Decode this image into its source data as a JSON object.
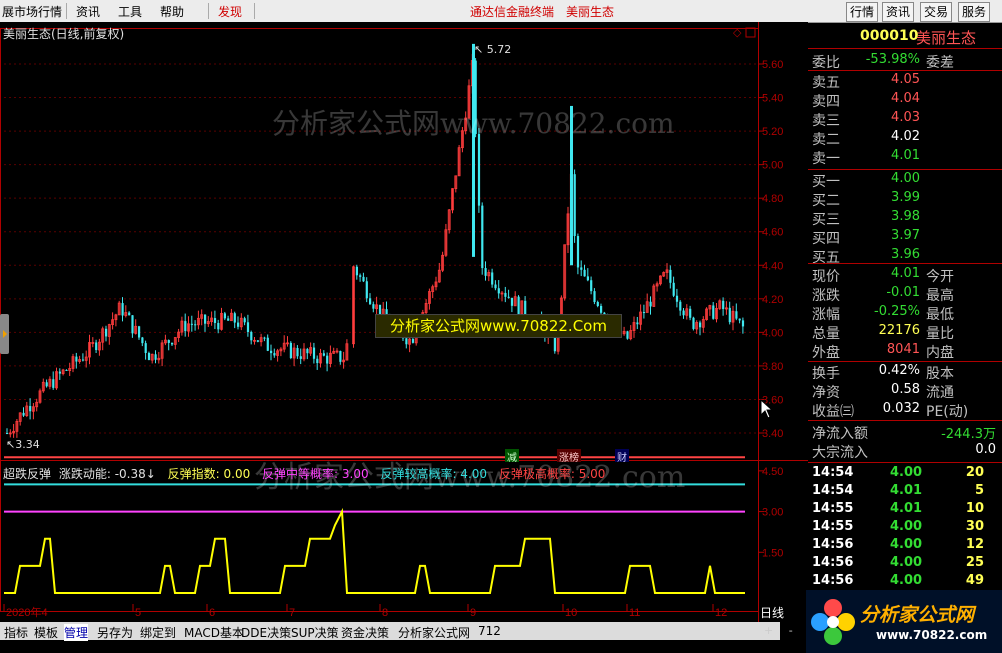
{
  "menu": {
    "items": [
      "展市场行情",
      "资讯",
      "工具",
      "帮助",
      "发现"
    ],
    "center_title": "通达信金融终端",
    "center_stock": "美丽生态",
    "right_buttons": [
      "行情",
      "资讯",
      "交易",
      "服务"
    ]
  },
  "chart": {
    "title": "美丽生态(日线,前复权)",
    "high_label": "5.72",
    "low_label": "3.34",
    "price_ticks": [
      "5.60",
      "5.40",
      "5.20",
      "5.00",
      "4.80",
      "4.60",
      "4.40",
      "4.20",
      "4.00",
      "3.80",
      "3.60",
      "3.40"
    ],
    "markers": [
      "减",
      "涨榜",
      "财"
    ],
    "watermark": "分析家公式网www.70822.com",
    "ad_text": "分析家公式网www.70822.Com"
  },
  "indicator": {
    "name": "超跌反弹",
    "items": [
      {
        "text": "涨跌动能: -0.38↓",
        "color": "#e0e0e0"
      },
      {
        "text": "反弹指数: 0.00",
        "color": "#ffff55"
      },
      {
        "text": "反弹中等概率: 3.00",
        "color": "#ff44ff"
      },
      {
        "text": "反弹较高概率: 4.00",
        "color": "#33dddd"
      },
      {
        "text": "反弹极高概率: 5.00",
        "color": "#ff4444"
      }
    ],
    "ticks": [
      "4.50",
      "3.00",
      "1.50"
    ],
    "lines": [
      {
        "level": 5.0,
        "color": "#ff4444"
      },
      {
        "level": 4.0,
        "color": "#33dddd"
      },
      {
        "level": 3.0,
        "color": "#ff44ff"
      }
    ]
  },
  "xaxis": {
    "labels": [
      "2020年4",
      "5",
      "6",
      "7",
      "8",
      "9",
      "10",
      "11",
      "12"
    ]
  },
  "quote": {
    "code": "000010",
    "name": "美丽生态",
    "weibi_label": "委比",
    "weibi_value": "-53.98%",
    "weicha_label": "委差",
    "asks": [
      {
        "label": "卖五",
        "price": "4.05",
        "color": "#ff5555"
      },
      {
        "label": "卖四",
        "price": "4.04",
        "color": "#ff5555"
      },
      {
        "label": "卖三",
        "price": "4.03",
        "color": "#ff5555"
      },
      {
        "label": "卖二",
        "price": "4.02",
        "color": "#ffffff"
      },
      {
        "label": "卖一",
        "price": "4.01",
        "color": "#33dd33"
      }
    ],
    "bids": [
      {
        "label": "买一",
        "price": "4.00",
        "color": "#33dd33"
      },
      {
        "label": "买二",
        "price": "3.99",
        "color": "#33dd33"
      },
      {
        "label": "买三",
        "price": "3.98",
        "color": "#33dd33"
      },
      {
        "label": "买四",
        "price": "3.97",
        "color": "#33dd33"
      },
      {
        "label": "买五",
        "price": "3.96",
        "color": "#33dd33"
      }
    ],
    "stats": [
      {
        "label": "现价",
        "value": "4.01",
        "color": "#33dd33",
        "label2": "今开"
      },
      {
        "label": "涨跌",
        "value": "-0.01",
        "color": "#33dd33",
        "label2": "最高"
      },
      {
        "label": "涨幅",
        "value": "-0.25%",
        "color": "#33dd33",
        "label2": "最低"
      },
      {
        "label": "总量",
        "value": "22176",
        "color": "#ffff55",
        "label2": "量比"
      },
      {
        "label": "外盘",
        "value": "8041",
        "color": "#ff5555",
        "label2": "内盘"
      }
    ],
    "stats2": [
      {
        "label": "换手",
        "value": "0.42%",
        "color": "#ffffff",
        "label2": "股本"
      },
      {
        "label": "净资",
        "value": "0.58",
        "color": "#ffffff",
        "label2": "流通"
      },
      {
        "label": "收益㈢",
        "value": "0.032",
        "color": "#ffffff",
        "label2": "PE(动)"
      }
    ],
    "flow": [
      {
        "label": "净流入额",
        "value": "-244.3万",
        "color": "#33dd33"
      },
      {
        "label": "大宗流入",
        "value": "0.0",
        "color": "#ffffff"
      }
    ],
    "trades": [
      {
        "time": "14:54",
        "price": "4.00",
        "vol": "20"
      },
      {
        "time": "14:54",
        "price": "4.01",
        "vol": "5"
      },
      {
        "time": "14:55",
        "price": "4.01",
        "vol": "10"
      },
      {
        "time": "14:55",
        "price": "4.00",
        "vol": "30"
      },
      {
        "time": "14:56",
        "price": "4.00",
        "vol": "12"
      },
      {
        "time": "14:56",
        "price": "4.00",
        "vol": "25"
      },
      {
        "time": "14:56",
        "price": "4.00",
        "vol": "49"
      }
    ]
  },
  "bottom_tabs": [
    "指标",
    "模板",
    "管理",
    "另存为",
    "绑定到",
    "MACD基本",
    "DDE决策",
    "SUP决策",
    "资金决策",
    "分析家公式网",
    "712"
  ],
  "bottom_right": "日线",
  "logo": {
    "line1": "分析家公式网",
    "line2": "www.70822.com"
  }
}
